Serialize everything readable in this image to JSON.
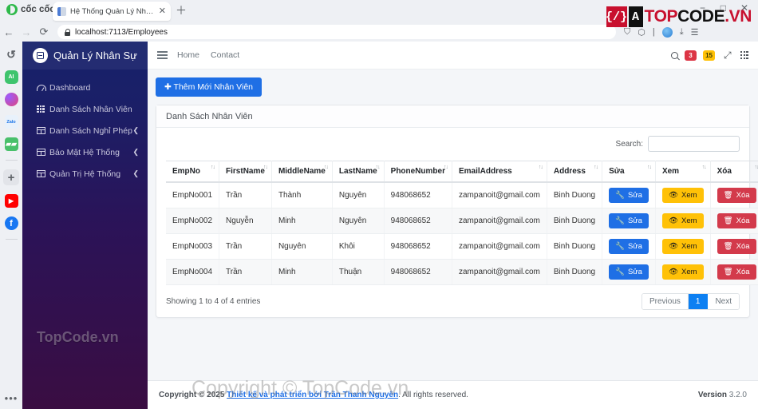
{
  "browser": {
    "brand": "cốc cốc",
    "tab_title": "Hệ Thống Quản Lý Nhân Sự",
    "tab_close": "✕",
    "new_tab": "＋",
    "win_min": "−",
    "win_max": "□",
    "win_close": "✕",
    "back": "←",
    "forward": "→",
    "reload": "⟳",
    "url": "localhost:7113/Employees",
    "toolbar_icons": [
      "shield-icon",
      "puzzle-icon",
      "profile-avatar",
      "download-icon",
      "menu-icon"
    ],
    "rail": [
      {
        "name": "history-icon",
        "label": "↺"
      },
      {
        "name": "ai-icon",
        "label": "AI"
      },
      {
        "name": "messenger-icon",
        "label": ""
      },
      {
        "name": "zalo-icon",
        "label": "Zalo"
      },
      {
        "name": "game-icon",
        "label": "🎮"
      },
      {
        "name": "add-icon",
        "label": "+"
      },
      {
        "name": "youtube-icon",
        "label": "▶"
      },
      {
        "name": "facebook-icon",
        "label": "f"
      }
    ],
    "rail_more": "•••"
  },
  "watermark": {
    "logo_left": "{/}",
    "logo_right": "A",
    "top": "TOP",
    "code": "CODE",
    "vn": ".VN",
    "sidebar": "TopCode.vn",
    "center": "Copyright © TopCode.vn"
  },
  "sidebar": {
    "brand": "Quản Lý Nhân Sự",
    "items": [
      {
        "label": "Dashboard",
        "icon": "dashboard-icon",
        "caret": ""
      },
      {
        "label": "Danh Sách Nhân Viên",
        "icon": "grid-icon",
        "caret": ""
      },
      {
        "label": "Danh Sách Nghỉ Phép",
        "icon": "table-icon",
        "caret": "❮"
      },
      {
        "label": "Bảo Mật Hệ Thống",
        "icon": "table-icon",
        "caret": "❮"
      },
      {
        "label": "Quản Trị Hệ Thống",
        "icon": "table-icon",
        "caret": "❮"
      }
    ]
  },
  "topbar": {
    "nav": [
      "Home",
      "Contact"
    ],
    "badge_red": "3",
    "badge_yellow": "15"
  },
  "main": {
    "add_button": "✚ Thêm Mới Nhân Viên",
    "card_title": "Danh Sách Nhân Viên",
    "search_label": "Search:",
    "search_value": "",
    "search_placeholder": "",
    "columns": [
      "EmpNo",
      "FirstName",
      "MiddleName",
      "LastName",
      "PhoneNumber",
      "EmailAddress",
      "Address",
      "Sửa",
      "Xem",
      "Xóa"
    ],
    "sort_indicator": "↑↓",
    "rows": [
      {
        "empno": "EmpNo001",
        "first": "Trần",
        "middle": "Thành",
        "last": "Nguyên",
        "phone": "948068652",
        "email": "zampanoit@gmail.com",
        "address": "Binh Duong"
      },
      {
        "empno": "EmpNo002",
        "first": "Nguyễn",
        "middle": "Minh",
        "last": "Nguyên",
        "phone": "948068652",
        "email": "zampanoit@gmail.com",
        "address": "Binh Duong"
      },
      {
        "empno": "EmpNo003",
        "first": "Trần",
        "middle": "Nguyên",
        "last": "Khôi",
        "phone": "948068652",
        "email": "zampanoit@gmail.com",
        "address": "Binh Duong"
      },
      {
        "empno": "EmpNo004",
        "first": "Trần",
        "middle": "Minh",
        "last": "Thuận",
        "phone": "948068652",
        "email": "zampanoit@gmail.com",
        "address": "Binh Duong"
      }
    ],
    "btn_edit": "Sửa",
    "btn_view": "Xem",
    "btn_delete": "Xóa",
    "showing": "Showing 1 to 4 of 4 entries",
    "pager": {
      "previous": "Previous",
      "page": "1",
      "next": "Next"
    }
  },
  "footer": {
    "copyright_prefix": "Copyright © 2025",
    "link": "Thiết kế và phát triển bởi Trần Thanh Nguyên",
    "suffix": ". All rights reserved.",
    "version_label": "Version",
    "version_value": "3.2.0"
  },
  "colors": {
    "primary": "#1f6fe5",
    "warning": "#ffc107",
    "danger": "#d33a4b",
    "sidebar_top": "#16216b",
    "sidebar_bottom": "#3a0d42",
    "brand_red": "#c8102e"
  }
}
